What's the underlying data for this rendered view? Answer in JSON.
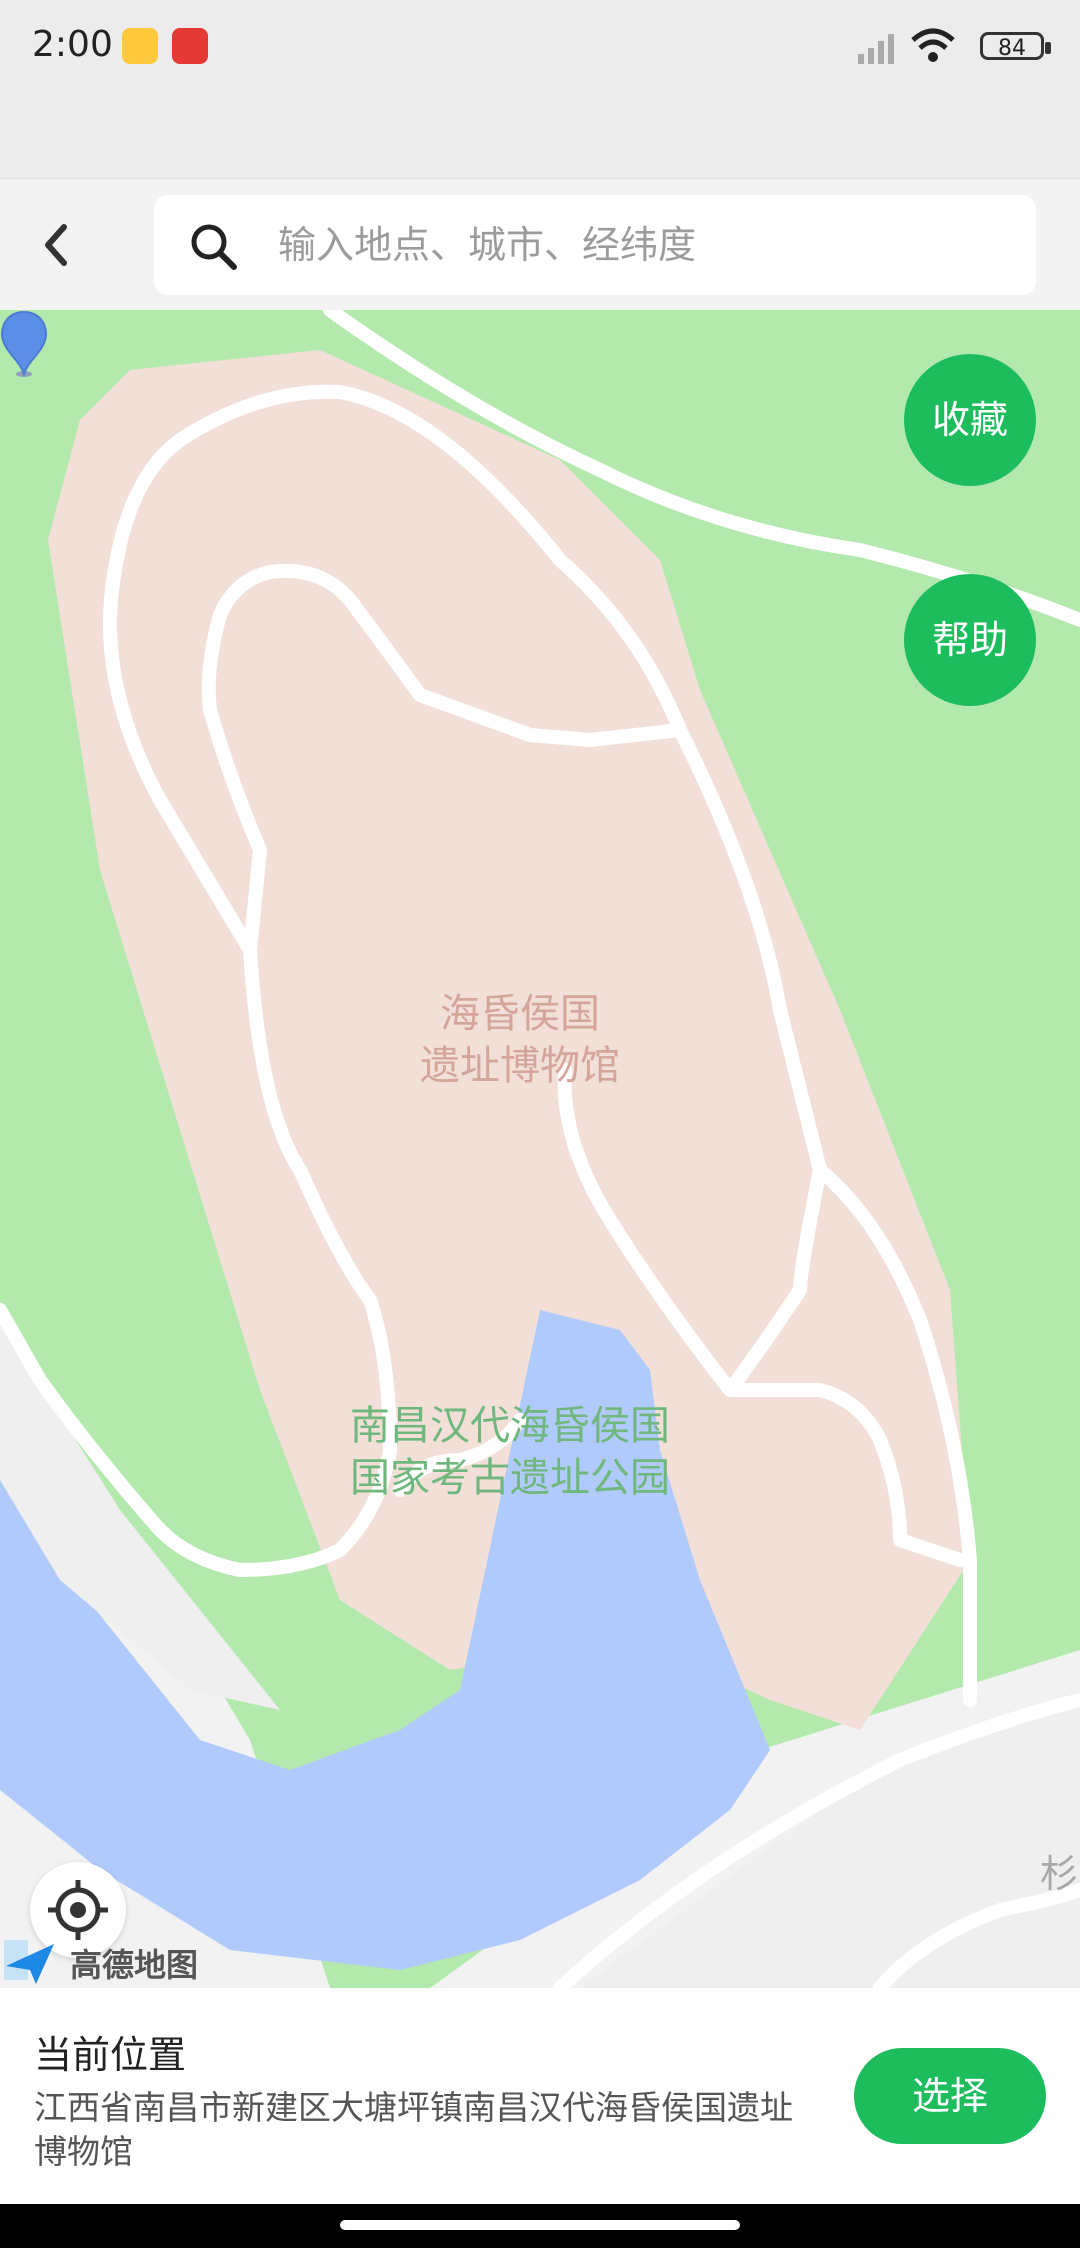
{
  "status_bar": {
    "time": "2:00",
    "battery": "84",
    "icons": [
      "signal-icon",
      "wifi-icon",
      "battery-icon"
    ]
  },
  "header": {
    "back_icon": "chevron-left-icon",
    "search_placeholder": "输入地点、城市、经纬度",
    "search_value": ""
  },
  "map": {
    "labels": {
      "museum_line1": "海昏侯国",
      "museum_line2": "遗址博物馆",
      "park_line1": "南昌汉代海昏侯国",
      "park_line2": "国家考古遗址公园",
      "edge_label": "杉"
    },
    "buttons": {
      "favorite": "收藏",
      "help": "帮助"
    },
    "brand": "高德地图",
    "colors": {
      "green": "#b4e9ae",
      "site": "#f2e0d8",
      "water": "#b0cbfb",
      "accent": "#1dbd5e"
    }
  },
  "bottom": {
    "title": "当前位置",
    "address": "江西省南昌市新建区大塘坪镇南昌汉代海昏侯国遗址博物馆",
    "select_label": "选择"
  }
}
